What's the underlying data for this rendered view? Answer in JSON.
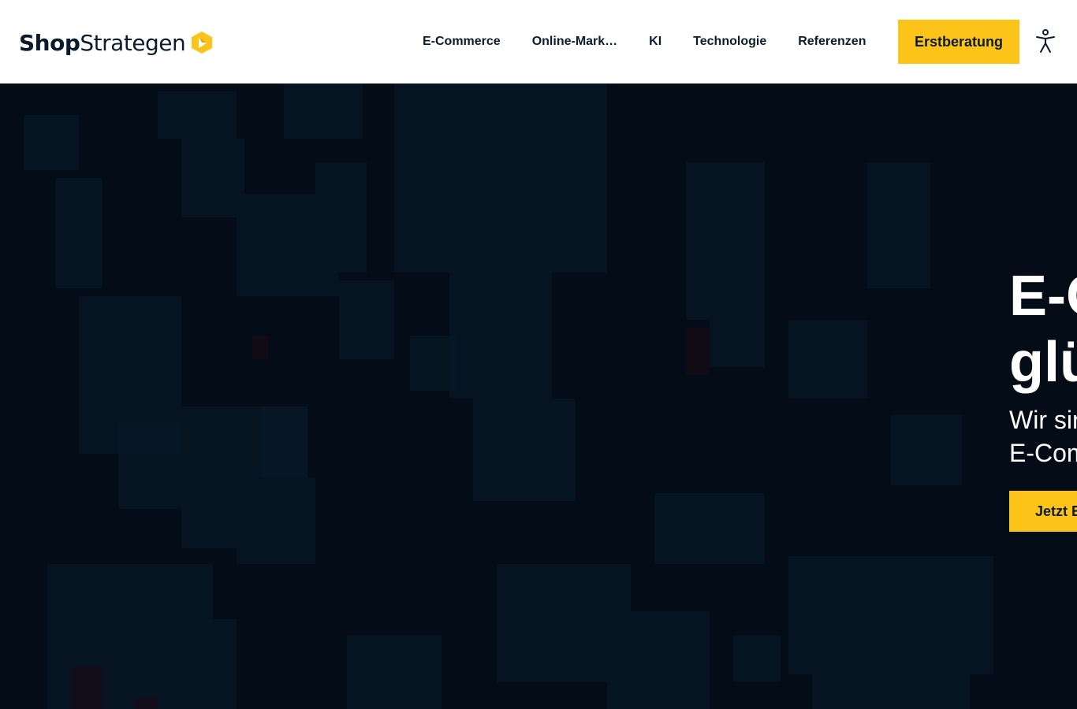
{
  "brand": {
    "logo_part1": "Shop",
    "logo_part2": "Strategen",
    "logo_icon": "hexagon-play-icon",
    "accent_color": "#fcc419",
    "dark_color": "#0b1c2c",
    "hero_background": "#040d17"
  },
  "nav": {
    "items": [
      {
        "label": "E-Commerce"
      },
      {
        "label": "Online-Mark…"
      },
      {
        "label": "KI"
      },
      {
        "label": "Technologie"
      },
      {
        "label": "Referenzen"
      }
    ],
    "cta_label": "Erstberatung",
    "accessibility_icon": "accessibility-icon"
  },
  "hero": {
    "title_line1": "E-C",
    "title_line2": "glü",
    "subtitle_line1": "Wir sin",
    "subtitle_line2": "E-Com",
    "button_label": "Jetzt E"
  }
}
